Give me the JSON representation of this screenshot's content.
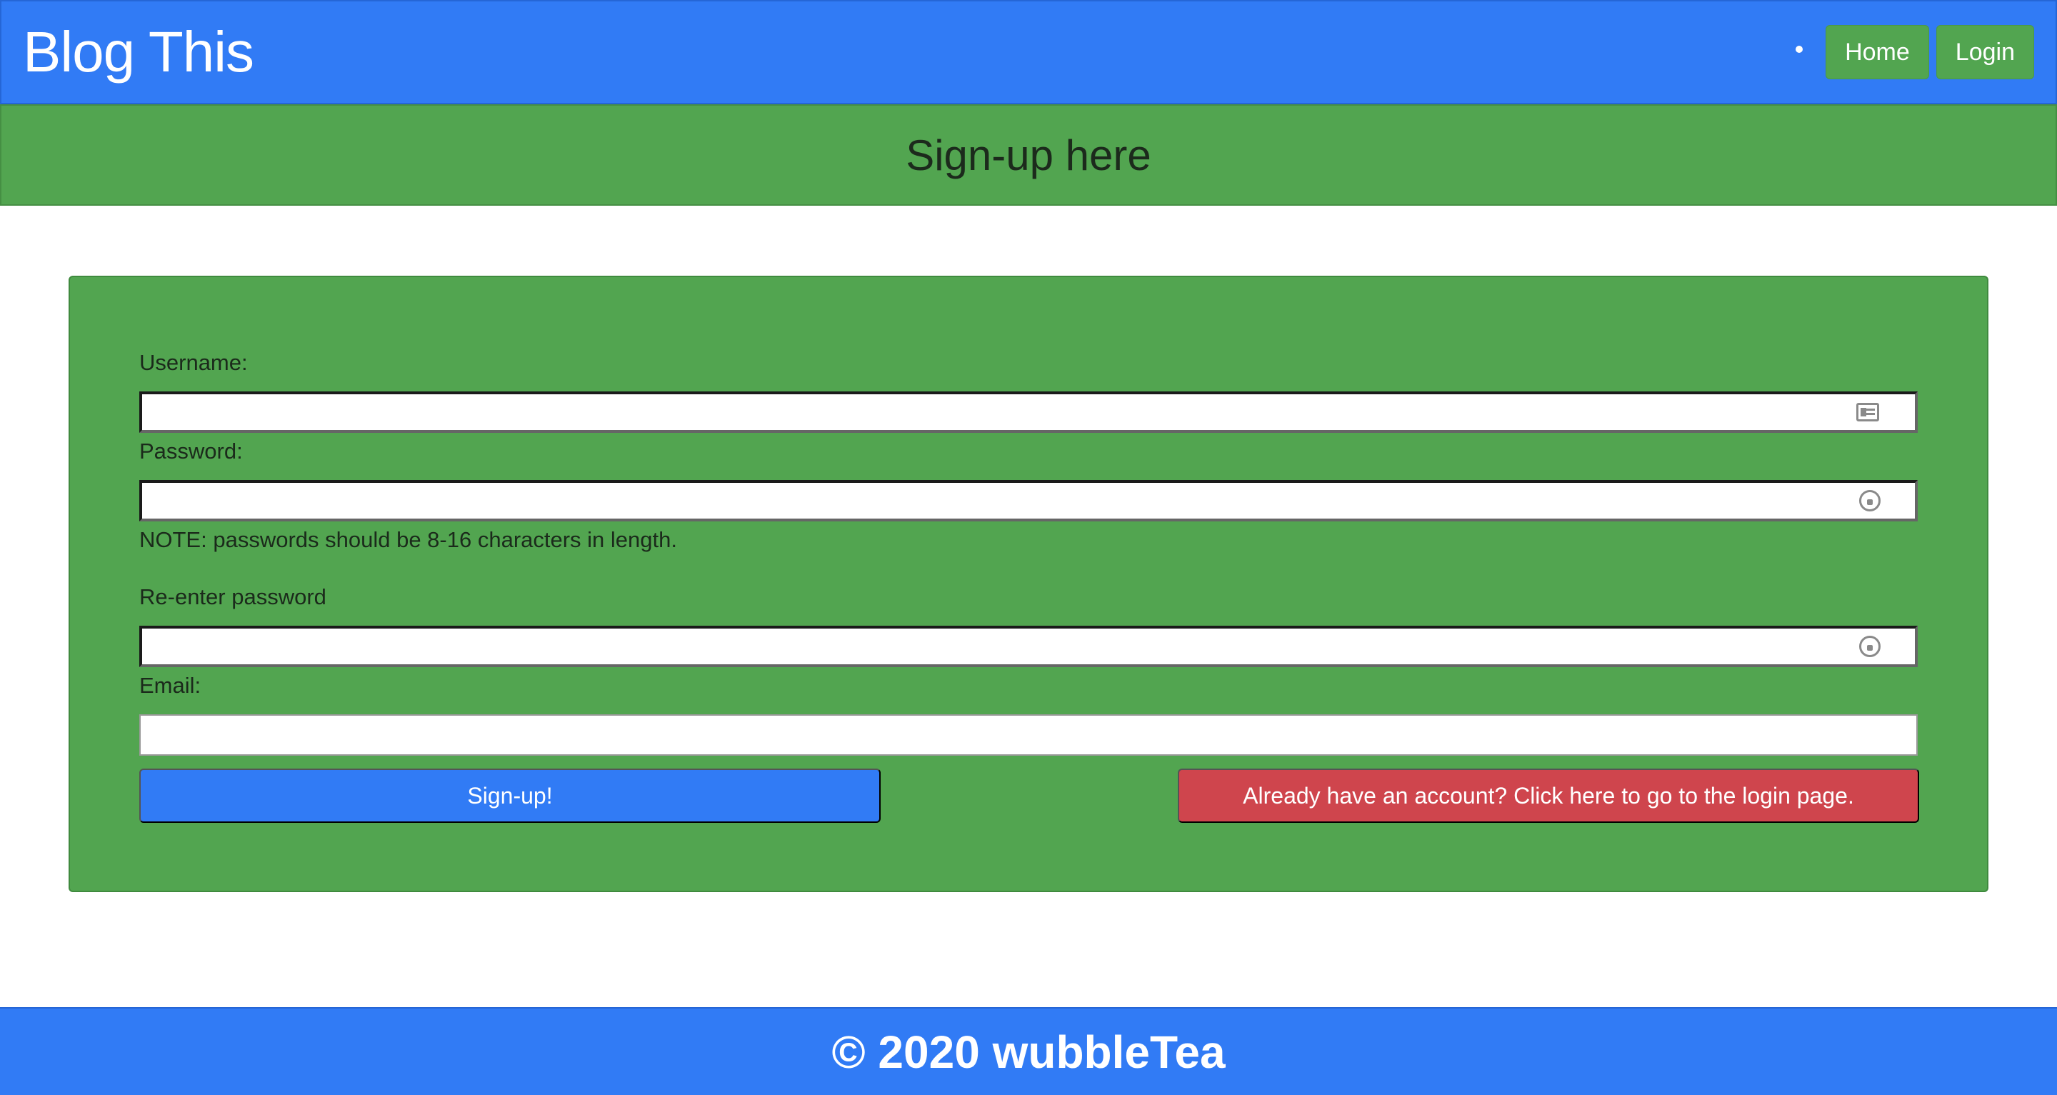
{
  "navbar": {
    "brand": "Blog This",
    "links": [
      {
        "label": "Home"
      },
      {
        "label": "Login"
      }
    ]
  },
  "banner": {
    "title": "Sign-up here"
  },
  "form": {
    "username_label": "Username:",
    "username_value": "",
    "password_label": "Password:",
    "password_value": "",
    "password_note": "NOTE: passwords should be 8-16 characters in length.",
    "reenter_label": "Re-enter password",
    "reenter_value": "",
    "email_label": "Email:",
    "email_value": "",
    "signup_button": "Sign-up!",
    "login_button": "Already have an account? Click here to go to the login page."
  },
  "footer": {
    "text": "© 2020 wubbleTea"
  },
  "colors": {
    "primary": "#317bf5",
    "success": "#52a550",
    "danger": "#cf454d"
  },
  "icons": {
    "username_field": "contact-card-icon",
    "password_field": "password-key-icon",
    "reenter_field": "password-key-icon"
  }
}
